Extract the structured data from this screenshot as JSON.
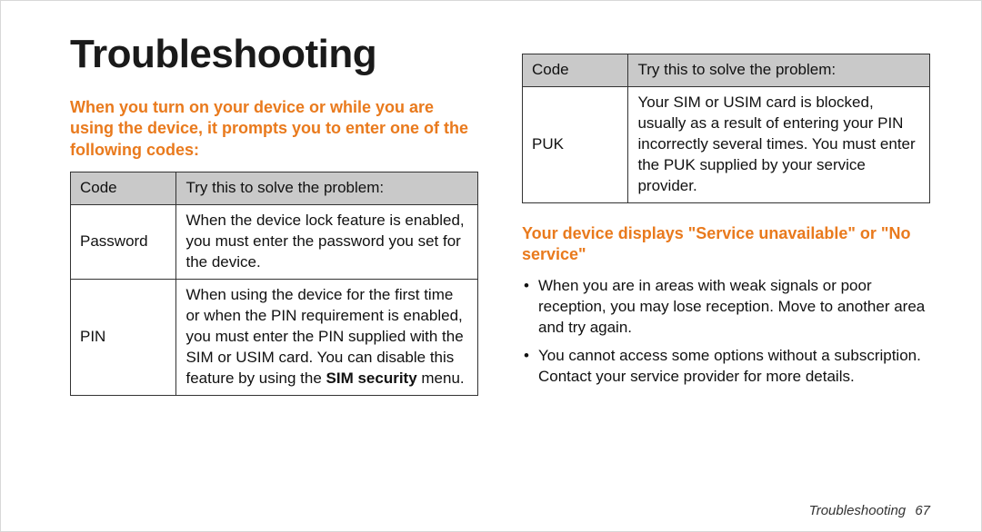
{
  "title": "Troubleshooting",
  "left": {
    "subhead": "When you turn on your device or while you are using the device, it prompts you to enter one of the following codes:",
    "table": {
      "head_code": "Code",
      "head_try": "Try this to solve the problem:",
      "rows": [
        {
          "code": "Password",
          "try": "When the device lock feature is enabled, you must enter the password you set for the device."
        },
        {
          "code": "PIN",
          "try_pre": "When using the device for the first time or when the PIN requirement is enabled, you must enter the PIN supplied with the SIM or USIM card. You can disable this feature by using the ",
          "try_strong": "SIM security",
          "try_post": " menu."
        }
      ]
    }
  },
  "right": {
    "table": {
      "head_code": "Code",
      "head_try": "Try this to solve the problem:",
      "rows": [
        {
          "code": "PUK",
          "try": "Your SIM or USIM card is blocked, usually as a result of entering your PIN incorrectly several times. You must enter the PUK supplied by your service provider."
        }
      ]
    },
    "subhead": "Your device displays \"Service unavailable\" or \"No service\"",
    "bullets": [
      "When you are in areas with weak signals or poor reception, you may lose reception. Move to another area and try again.",
      "You cannot access some options without a subscription. Contact your service provider for more details."
    ]
  },
  "footer": {
    "section": "Troubleshooting",
    "page": "67"
  }
}
